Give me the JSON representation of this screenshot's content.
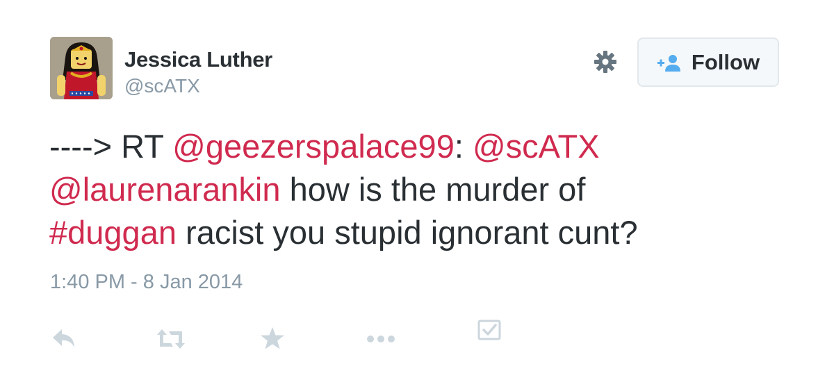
{
  "author": {
    "name": "Jessica Luther",
    "handle": "@scATX",
    "avatar_icon": "lego-wonder-woman-avatar"
  },
  "header": {
    "settings_icon": "gear-icon",
    "follow_label": "Follow",
    "follow_icon": "add-user-icon"
  },
  "tweet": {
    "prefix": "---->",
    "rt": "RT",
    "mention_1": "@geezerspalace99",
    "colon": ":",
    "mention_2": "@scATX",
    "mention_3": "@laurenarankin",
    "text_1": "how is the murder of",
    "hashtag": "#duggan",
    "text_2": "racist you stupid ignorant cunt?",
    "timestamp": "1:40 PM - 8 Jan 2014"
  },
  "actions": [
    "reply-icon",
    "retweet-icon",
    "favorite-icon",
    "more-icon",
    "checkbox-icon"
  ],
  "colors": {
    "text": "#292f33",
    "muted": "#8899a6",
    "link": "#d02a4f",
    "action_icon": "#ccd6dd",
    "button_border": "#e1e8ed"
  }
}
